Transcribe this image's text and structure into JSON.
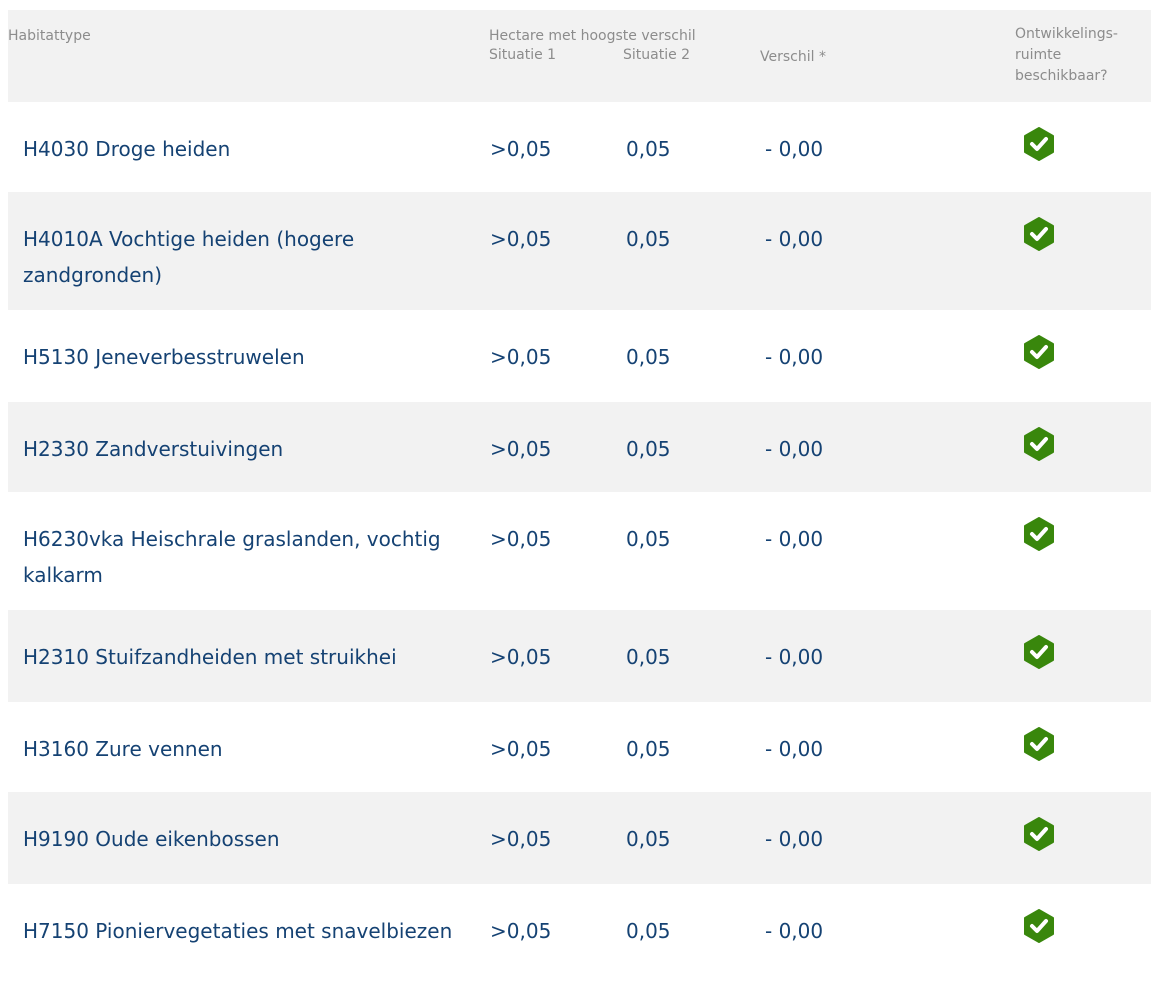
{
  "header": {
    "habitattype": "Habitattype",
    "hectare_group": "Hectare met hoogste verschil",
    "situatie1": "Situatie 1",
    "situatie2": "Situatie 2",
    "verschil": "Verschil *",
    "ontwikkel_line1": "Ontwikkelings-",
    "ontwikkel_line2": "ruimte",
    "ontwikkel_line3": "beschikbaar?"
  },
  "colors": {
    "text": "#154273",
    "header_text": "#8c8c8c",
    "stripe": "#f2f2f2",
    "check_fill": "#39870c"
  },
  "rows": [
    {
      "name": "H4030 Droge heiden",
      "situatie1": ">0,05",
      "situatie2": "0,05",
      "verschil": "- 0,00",
      "beschikbaar": true,
      "icon": "check-badge-icon"
    },
    {
      "name": "H4010A Vochtige heiden (hogere zandgronden)",
      "situatie1": ">0,05",
      "situatie2": "0,05",
      "verschil": "- 0,00",
      "beschikbaar": true,
      "icon": "check-badge-icon"
    },
    {
      "name": "H5130 Jeneverbesstruwelen",
      "situatie1": ">0,05",
      "situatie2": "0,05",
      "verschil": "- 0,00",
      "beschikbaar": true,
      "icon": "check-badge-icon"
    },
    {
      "name": "H2330 Zandverstuivingen",
      "situatie1": ">0,05",
      "situatie2": "0,05",
      "verschil": "- 0,00",
      "beschikbaar": true,
      "icon": "check-badge-icon"
    },
    {
      "name": "H6230vka Heischrale graslanden, vochtig kalkarm",
      "situatie1": ">0,05",
      "situatie2": "0,05",
      "verschil": "- 0,00",
      "beschikbaar": true,
      "icon": "check-badge-icon"
    },
    {
      "name": "H2310 Stuifzandheiden met struikhei",
      "situatie1": ">0,05",
      "situatie2": "0,05",
      "verschil": "- 0,00",
      "beschikbaar": true,
      "icon": "check-badge-icon"
    },
    {
      "name": "H3160 Zure vennen",
      "situatie1": ">0,05",
      "situatie2": "0,05",
      "verschil": "- 0,00",
      "beschikbaar": true,
      "icon": "check-badge-icon"
    },
    {
      "name": "H9190 Oude eikenbossen",
      "situatie1": ">0,05",
      "situatie2": "0,05",
      "verschil": "- 0,00",
      "beschikbaar": true,
      "icon": "check-badge-icon"
    },
    {
      "name": "H7150 Pioniervegetaties met snavelbiezen",
      "situatie1": ">0,05",
      "situatie2": "0,05",
      "verschil": "- 0,00",
      "beschikbaar": true,
      "icon": "check-badge-icon"
    }
  ]
}
